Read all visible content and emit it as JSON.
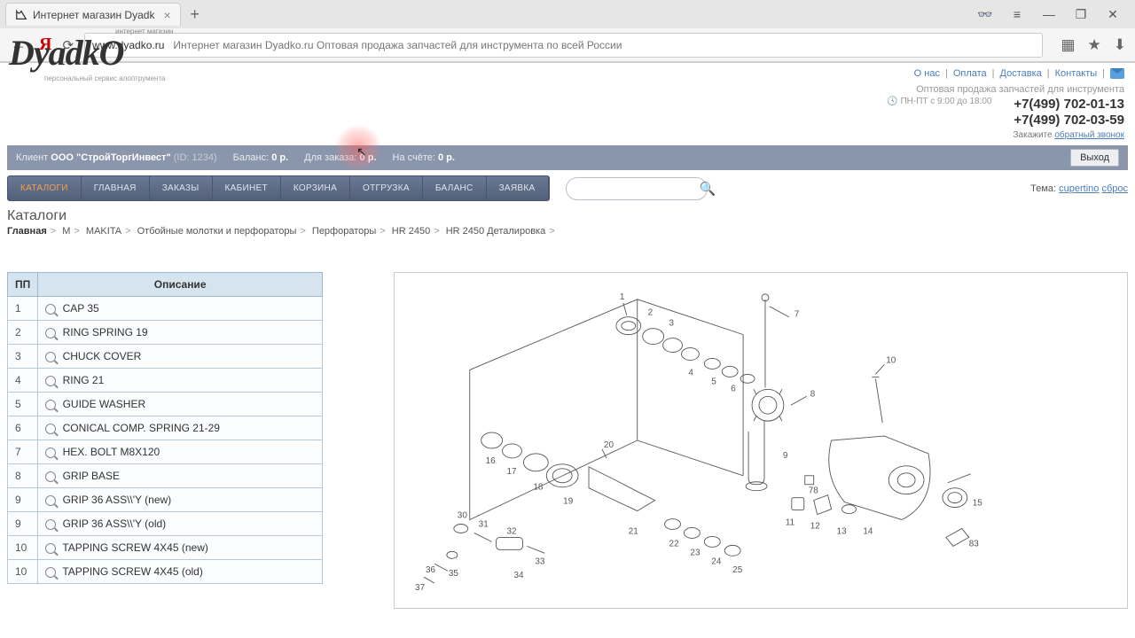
{
  "browser": {
    "tab_title": "Интернет магазин Dyadk",
    "url_domain": "www.dyadko.ru",
    "url_title": "Интернет магазин Dyadko.ru Оптовая продажа запчастей для инструмента по всей России"
  },
  "header": {
    "logo_top_sub": "интернет магазин",
    "logo_main": "DyadkO",
    "logo_bottom_sub": "персональный сервис алоптрумента",
    "links": [
      "О нас",
      "Оплата",
      "Доставка",
      "Контакты"
    ],
    "slogan": "Оптовая продажа запчастей для инструмента",
    "hours": "ПН-ПТ с 9:00 до 18:00",
    "phone1": "+7(499) 702-01-13",
    "phone2": "+7(499) 702-03-59",
    "callback_prefix": "Закажите ",
    "callback_link": "обратный звонок"
  },
  "client": {
    "label": "Клиент",
    "name": "ООО \"СтройТоргИнвест\"",
    "id_label": "(ID: 1234)",
    "balance_label": "Баланс:",
    "balance_value": "0 р.",
    "order_label": "Для заказа:",
    "order_value": "0 р.",
    "account_label": "На счёте:",
    "account_value": "0 р.",
    "logout": "Выход"
  },
  "nav": {
    "items": [
      "КАТАЛОГИ",
      "ГЛАВНАЯ",
      "ЗАКАЗЫ",
      "КАБИНЕТ",
      "КОРЗИНА",
      "ОТГРУЗКА",
      "БАЛАНС",
      "ЗАЯВКА"
    ]
  },
  "theme": {
    "label": "Тема:",
    "name": "cupertino",
    "reset": "сброс"
  },
  "section": "Каталоги",
  "crumbs": [
    "Главная",
    "М",
    "MAKITA",
    "Отбойные молотки и перфораторы",
    "Перфораторы",
    "HR 2450",
    "HR 2450 Деталировка"
  ],
  "table": {
    "col_pp": "ПП",
    "col_desc": "Описание",
    "rows": [
      {
        "n": "1",
        "d": "CAP 35"
      },
      {
        "n": "2",
        "d": "RING SPRING 19"
      },
      {
        "n": "3",
        "d": "CHUCK COVER"
      },
      {
        "n": "4",
        "d": "RING 21"
      },
      {
        "n": "5",
        "d": "GUIDE WASHER"
      },
      {
        "n": "6",
        "d": "CONICAL COMP. SPRING 21-29"
      },
      {
        "n": "7",
        "d": "HEX. BOLT M8X120"
      },
      {
        "n": "8",
        "d": "GRIP BASE"
      },
      {
        "n": "9",
        "d": "GRIP 36 ASS\\\\'Y (new)"
      },
      {
        "n": "9",
        "d": "GRIP 36 ASS\\\\'Y (old)"
      },
      {
        "n": "10",
        "d": "TAPPING SCREW 4X45 (new)"
      },
      {
        "n": "10",
        "d": "TAPPING SCREW 4X45 (old)"
      }
    ]
  },
  "diagram_labels": [
    "1",
    "2",
    "3",
    "4",
    "5",
    "6",
    "7",
    "8",
    "9",
    "10",
    "11",
    "12",
    "13",
    "14",
    "15",
    "16",
    "17",
    "18",
    "19",
    "20",
    "21",
    "22",
    "23",
    "24",
    "25",
    "30",
    "31",
    "32",
    "33",
    "34",
    "35",
    "36",
    "37",
    "78",
    "83"
  ]
}
